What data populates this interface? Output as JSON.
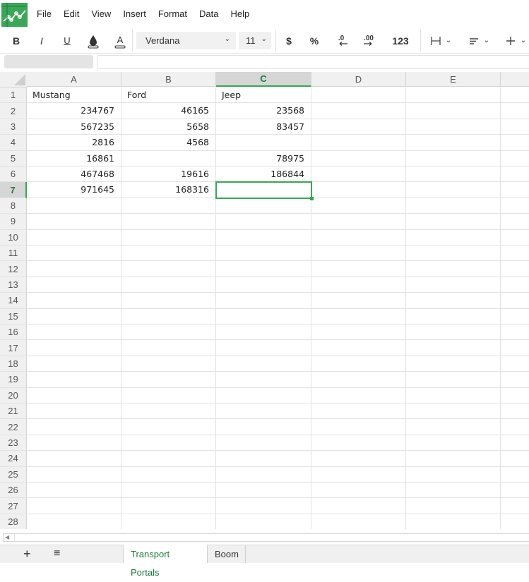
{
  "menu": {
    "items": [
      "File",
      "Edit",
      "View",
      "Insert",
      "Format",
      "Data",
      "Help"
    ]
  },
  "toolbar": {
    "bold": "B",
    "italic": "I",
    "underline": "U",
    "fill_icon": "paint-bucket-icon",
    "text_color": "A",
    "font": "Verdana",
    "font_size": "11",
    "currency": "$",
    "percent": "%",
    "decrease_decimals": ".0",
    "increase_decimals": ".00",
    "number_format": "123",
    "borders_icon": "borders-icon",
    "align_icon": "align-left-icon",
    "valign_icon": "vertical-align-icon"
  },
  "formula_bar": {
    "name_box": "",
    "value": ""
  },
  "grid": {
    "columns": [
      "A",
      "B",
      "C",
      "D",
      "E"
    ],
    "active_column": "C",
    "active_row": 7,
    "rows": [
      {
        "n": "1",
        "cells": [
          "Mustang",
          "Ford",
          "Jeep",
          "",
          ""
        ]
      },
      {
        "n": "2",
        "cells": [
          "234767",
          "46165",
          "23568",
          "",
          ""
        ]
      },
      {
        "n": "3",
        "cells": [
          "567235",
          "5658",
          "83457",
          "",
          ""
        ]
      },
      {
        "n": "4",
        "cells": [
          "2816",
          "4568",
          "",
          "",
          ""
        ]
      },
      {
        "n": "5",
        "cells": [
          "16861",
          "",
          "78975",
          "",
          ""
        ]
      },
      {
        "n": "6",
        "cells": [
          "467468",
          "19616",
          "186844",
          "",
          ""
        ]
      },
      {
        "n": "7",
        "cells": [
          "971645",
          "168316",
          "",
          "",
          ""
        ]
      },
      {
        "n": "8",
        "cells": [
          "",
          "",
          "",
          "",
          ""
        ]
      },
      {
        "n": "9",
        "cells": [
          "",
          "",
          "",
          "",
          ""
        ]
      },
      {
        "n": "10",
        "cells": [
          "",
          "",
          "",
          "",
          ""
        ]
      },
      {
        "n": "11",
        "cells": [
          "",
          "",
          "",
          "",
          ""
        ]
      },
      {
        "n": "12",
        "cells": [
          "",
          "",
          "",
          "",
          ""
        ]
      },
      {
        "n": "13",
        "cells": [
          "",
          "",
          "",
          "",
          ""
        ]
      },
      {
        "n": "14",
        "cells": [
          "",
          "",
          "",
          "",
          ""
        ]
      },
      {
        "n": "15",
        "cells": [
          "",
          "",
          "",
          "",
          ""
        ]
      },
      {
        "n": "16",
        "cells": [
          "",
          "",
          "",
          "",
          ""
        ]
      },
      {
        "n": "17",
        "cells": [
          "",
          "",
          "",
          "",
          ""
        ]
      },
      {
        "n": "18",
        "cells": [
          "",
          "",
          "",
          "",
          ""
        ]
      },
      {
        "n": "19",
        "cells": [
          "",
          "",
          "",
          "",
          ""
        ]
      },
      {
        "n": "20",
        "cells": [
          "",
          "",
          "",
          "",
          ""
        ]
      },
      {
        "n": "21",
        "cells": [
          "",
          "",
          "",
          "",
          ""
        ]
      },
      {
        "n": "22",
        "cells": [
          "",
          "",
          "",
          "",
          ""
        ]
      },
      {
        "n": "23",
        "cells": [
          "",
          "",
          "",
          "",
          ""
        ]
      },
      {
        "n": "24",
        "cells": [
          "",
          "",
          "",
          "",
          ""
        ]
      },
      {
        "n": "25",
        "cells": [
          "",
          "",
          "",
          "",
          ""
        ]
      },
      {
        "n": "26",
        "cells": [
          "",
          "",
          "",
          "",
          ""
        ]
      },
      {
        "n": "27",
        "cells": [
          "",
          "",
          "",
          "",
          ""
        ]
      },
      {
        "n": "28",
        "cells": [
          "",
          "",
          "",
          "",
          ""
        ]
      }
    ]
  },
  "sheets": {
    "add_icon": "+",
    "list_icon": "≡",
    "tabs": [
      "Transport Portals",
      "Boom"
    ],
    "active": "Transport Portals"
  },
  "colors": {
    "accent": "#35a853",
    "accent_text": "#1e7b3c",
    "header_bg": "#f0f0f0"
  }
}
